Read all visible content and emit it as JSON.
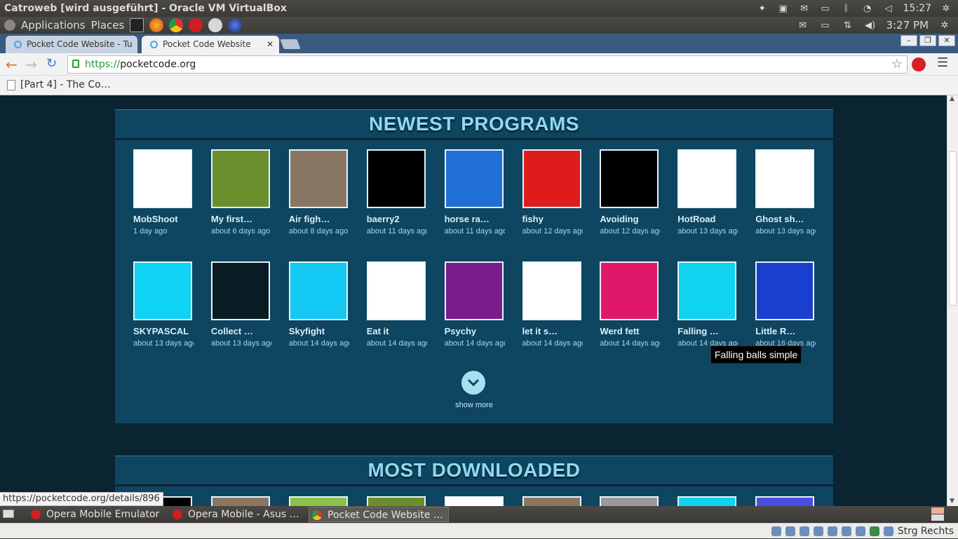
{
  "vbox": {
    "title": "Catroweb [wird ausgeführt] - Oracle VM VirtualBox",
    "clock": "15:27",
    "host_key": "Strg Rechts"
  },
  "panel": {
    "applications": "Applications",
    "places": "Places",
    "clock": "3:27 PM"
  },
  "tabs": [
    {
      "label": "Pocket Code Website - Tu"
    },
    {
      "label": "Pocket Code Website"
    }
  ],
  "browser": {
    "url_scheme": "https://",
    "url_host": "pocketcode.org",
    "bookmark": "[Part 4] - The Co…",
    "status_url": "https://pocketcode.org/details/896",
    "tooltip": "Falling balls simple"
  },
  "newest": {
    "title": "NEWEST PROGRAMS",
    "show_more": "show more",
    "programs": [
      {
        "name": "MobShoot",
        "age": "1 day ago",
        "thumb": "#ffffff"
      },
      {
        "name": "My first…",
        "age": "about 6 days ago",
        "thumb": "#6b8f2c"
      },
      {
        "name": "Air figh…",
        "age": "about 8 days ago",
        "thumb": "#8a7763"
      },
      {
        "name": "baerry2",
        "age": "about 11 days ago",
        "thumb": "#000000"
      },
      {
        "name": "horse ra…",
        "age": "about 11 days ago",
        "thumb": "#1f6fd6"
      },
      {
        "name": "fishy",
        "age": "about 12 days ago",
        "thumb": "#e01b1b"
      },
      {
        "name": "Avoiding",
        "age": "about 12 days ago",
        "thumb": "#000000"
      },
      {
        "name": "HotRoad",
        "age": "about 13 days ago",
        "thumb": "#ffffff"
      },
      {
        "name": "Ghost sh…",
        "age": "about 13 days ago",
        "thumb": "#ffffff"
      },
      {
        "name": "SKYPASCAL",
        "age": "about 13 days ago",
        "thumb": "#10d4f5"
      },
      {
        "name": "Collect …",
        "age": "about 13 days ago",
        "thumb": "#0b1b24"
      },
      {
        "name": "Skyfight",
        "age": "about 14 days ago",
        "thumb": "#13c8f2"
      },
      {
        "name": "Eat it",
        "age": "about 14 days ago",
        "thumb": "#ffffff"
      },
      {
        "name": "Psychy",
        "age": "about 14 days ago",
        "thumb": "#7a1c8c"
      },
      {
        "name": "let it s…",
        "age": "about 14 days ago",
        "thumb": "#ffffff"
      },
      {
        "name": "Werd fett",
        "age": "about 14 days ago",
        "thumb": "#e0186a"
      },
      {
        "name": "Falling …",
        "age": "about 14 days ago",
        "thumb": "#10d4f0"
      },
      {
        "name": "Little R…",
        "age": "about 16 days ago",
        "thumb": "#1a3fcf"
      }
    ]
  },
  "most_downloaded": {
    "title": "MOST DOWNLOADED"
  },
  "taskbar": [
    {
      "label": "Opera Mobile Emulator"
    },
    {
      "label": "Opera Mobile - Asus …"
    },
    {
      "label": "Pocket Code Website …"
    }
  ],
  "colors": {
    "page_bg": "#0b2431",
    "section_bg": "#0e4560",
    "title": "#8fd8f0"
  }
}
